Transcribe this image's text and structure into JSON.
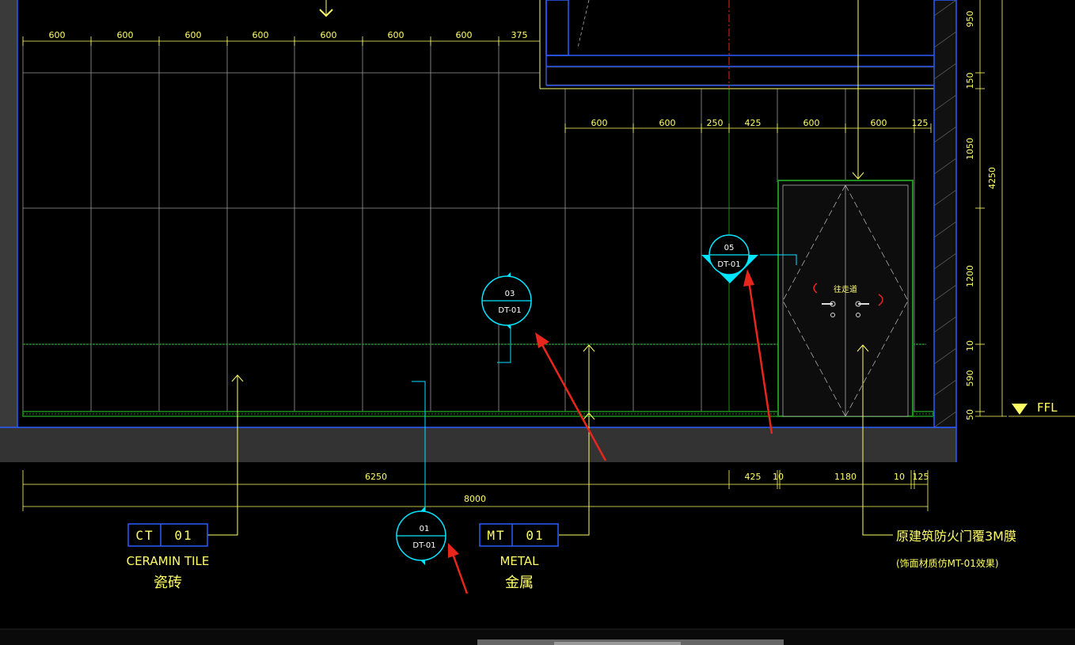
{
  "top_dims": [
    "600",
    "600",
    "600",
    "600",
    "600",
    "600",
    "600",
    "375"
  ],
  "mid_dims": [
    "600",
    "600",
    "250",
    "425",
    "600",
    "600",
    "125"
  ],
  "right_dims": [
    "950",
    "150",
    "1050",
    "1200",
    "10",
    "590",
    "50"
  ],
  "right_total": "4250",
  "bottom_dims": {
    "d6250": "6250",
    "d425": "425",
    "d10a": "10",
    "d1180": "1180",
    "d10b": "10",
    "d125": "125",
    "total": "8000"
  },
  "ffl_label": "FFL",
  "material_tags": {
    "ceramic": {
      "code": "CT",
      "num": "01",
      "en": "CERAMIN TILE",
      "zh": "瓷砖"
    },
    "metal": {
      "code": "MT",
      "num": "01",
      "en": "METAL",
      "zh": "金属"
    }
  },
  "detail_symbols": {
    "s01": {
      "num": "01",
      "ref": "DT-01"
    },
    "s03": {
      "num": "03",
      "ref": "DT-01"
    },
    "s05": {
      "num": "05",
      "ref": "DT-01"
    }
  },
  "door_note": {
    "line1": "原建筑防火门覆3M膜",
    "line2": "(饰面材质仿MT-01效果)",
    "sign": "往走道"
  },
  "colors": {
    "yellow": "#ffff66",
    "cyan": "#00e5ff",
    "green": "#1f8f1f",
    "blue": "#2b5cff",
    "red": "#e8261c",
    "grey": "#3a3a3a"
  }
}
